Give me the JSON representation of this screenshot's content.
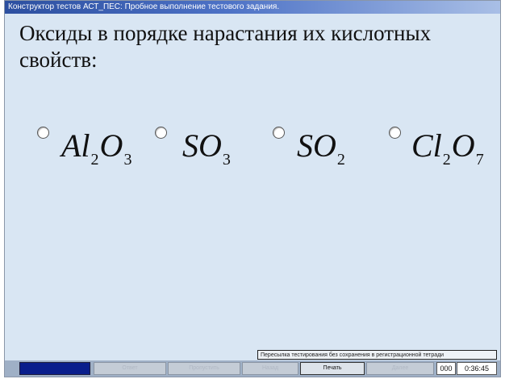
{
  "window": {
    "title": "Конструктор тестов АСТ_ПЕС: Пробное выполнение тестового задания."
  },
  "question": {
    "text": "Оксиды в порядке нарастания их кислотных свойств:"
  },
  "options": [
    {
      "parts": [
        "Al",
        "2",
        "O",
        "3"
      ]
    },
    {
      "parts": [
        "SO",
        "3"
      ]
    },
    {
      "parts": [
        "SO",
        "2"
      ]
    },
    {
      "parts": [
        "Cl",
        "2",
        "O",
        "7"
      ]
    }
  ],
  "hint": {
    "text": "Пересылка тестирования без сохранения в регистрационной тетради"
  },
  "statusbar": {
    "buttons": [
      {
        "label": "Ответ",
        "active": false
      },
      {
        "label": "Пропустить",
        "active": false
      },
      {
        "label": "Назад",
        "active": false
      },
      {
        "label": "Печать",
        "active": true
      },
      {
        "label": "Далее",
        "active": false
      }
    ],
    "counter": "000",
    "timer": "0:36:45"
  },
  "colors": {
    "background": "#d9e6f3",
    "progress_fill": "#0a1e8c",
    "titlebar": "#2c4fa0"
  }
}
